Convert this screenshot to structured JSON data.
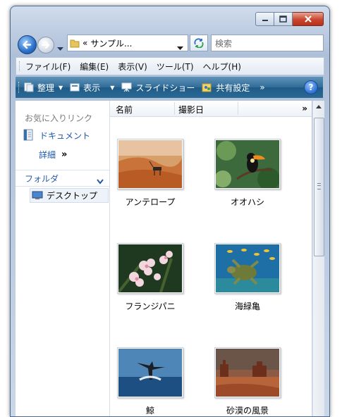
{
  "window": {
    "controls": {
      "minimize": "minimize-icon",
      "maximize": "maximize-icon",
      "close": "close-icon"
    }
  },
  "address_bar": {
    "prefix": "«",
    "path": "サンプル...",
    "search_placeholder": "検索"
  },
  "menu": [
    "ファイル(F)",
    "編集(E)",
    "表示(V)",
    "ツール(T)",
    "ヘルプ(H)"
  ],
  "toolbar": {
    "organize": "整理",
    "views": "表示",
    "slideshow": "スライドショー",
    "share": "共有設定",
    "more": "»",
    "help": "?"
  },
  "left_pane": {
    "favorites_header": "お気に入りリンク",
    "documents": "ドキュメント",
    "more": "詳細",
    "more_chevron": "»",
    "folders_header": "フォルダ",
    "desktop": "デスクトップ"
  },
  "columns": {
    "name": "名前",
    "date_taken": "撮影日",
    "more": "»"
  },
  "items": [
    {
      "caption": "アンテロープ"
    },
    {
      "caption": "オオハシ"
    },
    {
      "caption": "フランジパニ"
    },
    {
      "caption": "海緑亀"
    },
    {
      "caption": "鯨"
    },
    {
      "caption": "砂漠の風景"
    }
  ],
  "colors": {
    "toolbar": "#2f6c99",
    "link": "#1c58a8",
    "close": "#c9452f"
  }
}
